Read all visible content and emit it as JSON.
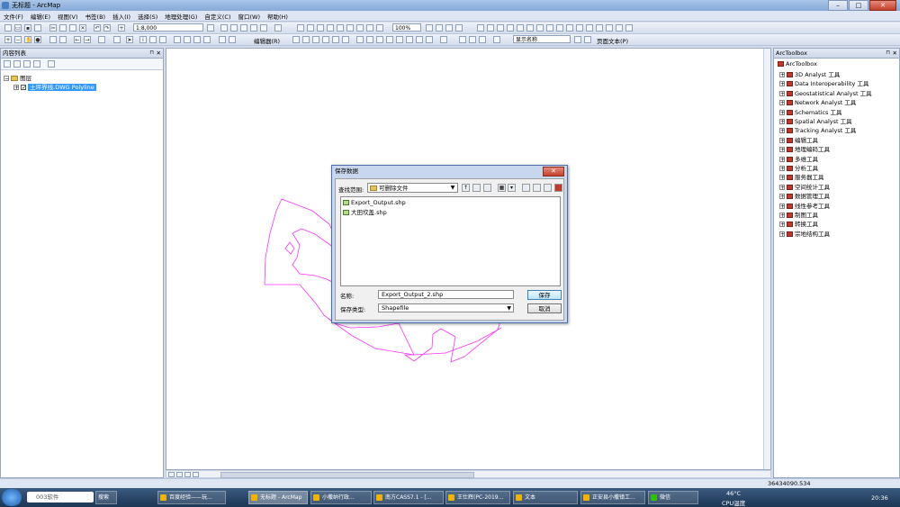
{
  "window": {
    "title": "无标题 - ArcMap"
  },
  "menu": [
    "文件(F)",
    "编辑(E)",
    "视图(V)",
    "书签(B)",
    "插入(I)",
    "选择(S)",
    "地理处理(G)",
    "自定义(C)",
    "窗口(W)",
    "帮助(H)"
  ],
  "toolbar": {
    "scale": "1:8,000",
    "zoom": "100%",
    "editor_label": "编辑器(R)",
    "display_name": "显示名称",
    "page_text": "页面文本(P)"
  },
  "toc": {
    "title": "内容列表",
    "group": "图层",
    "layer": "土坪界线.DWG Polyline"
  },
  "map": {
    "polygon_color": "#ff33ff"
  },
  "dialog": {
    "title": "保存数据",
    "lookin_label": "查找范围:",
    "lookin_value": "可删除文件",
    "files": [
      "Export_Output.shp",
      "大田坎盖.shp"
    ],
    "name_label": "名称:",
    "name_value": "Export_Output_2.shp",
    "type_label": "保存类型:",
    "type_value": "Shapefile",
    "save_label": "保存",
    "cancel_label": "取消"
  },
  "arctoolbox": {
    "title": "ArcToolbox",
    "root": "ArcToolbox",
    "items": [
      "3D Analyst 工具",
      "Data Interoperability 工具",
      "Geostatistical Analyst 工具",
      "Network Analyst 工具",
      "Schematics 工具",
      "Spatial Analyst 工具",
      "Tracking Analyst 工具",
      "编辑工具",
      "地理编码工具",
      "多维工具",
      "分析工具",
      "服务器工具",
      "空间统计工具",
      "数据管理工具",
      "线性参考工具",
      "制图工具",
      "转换工具",
      "宗地结构工具"
    ]
  },
  "status": {
    "coords": "36434090.534"
  },
  "taskbar": {
    "search_placeholder": "003软件",
    "search_button": "搜索",
    "tasks": [
      "百度经验——玩...",
      "无标题 - ArcMap",
      "小撒纳行政...",
      "南方CASS7.1 - [...",
      "王仕辉(PC-2019...",
      "文本",
      "正安县小撒镇工...",
      "微信"
    ],
    "temp": "46°C",
    "cpu": "CPU温度",
    "time": "20:36"
  }
}
